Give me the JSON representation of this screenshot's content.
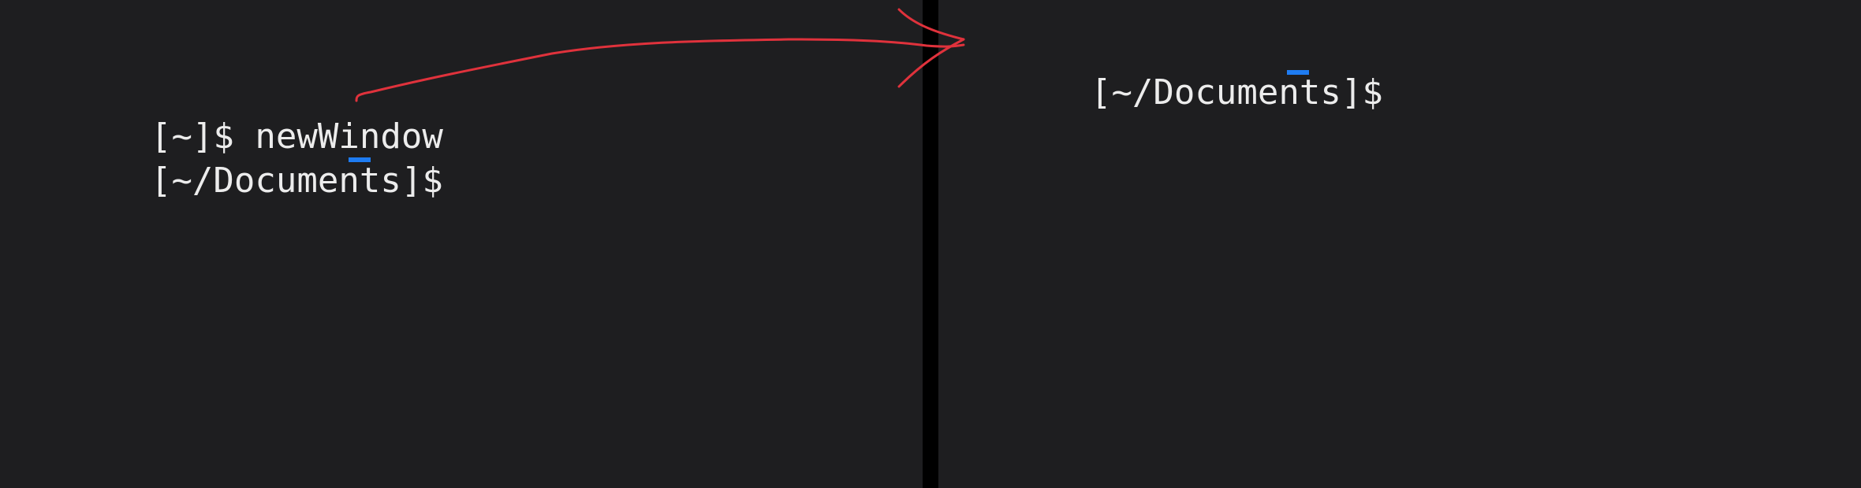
{
  "left_pane": {
    "lines": [
      {
        "prompt": "[~]$ ",
        "command": "newWindow"
      },
      {
        "prompt": "[~/Documents]$ ",
        "command": ""
      }
    ]
  },
  "right_pane": {
    "lines": [
      {
        "prompt": "[~/Documents]$ ",
        "command": ""
      }
    ]
  },
  "colors": {
    "background": "#1e1e20",
    "text": "#ececec",
    "cursor": "#1e7cf2",
    "annotation_arrow": "#e0323c",
    "divider": "#000000"
  },
  "icons": [
    "cursor-block",
    "battery-icon",
    "window-handle",
    "annotation-arrow"
  ]
}
